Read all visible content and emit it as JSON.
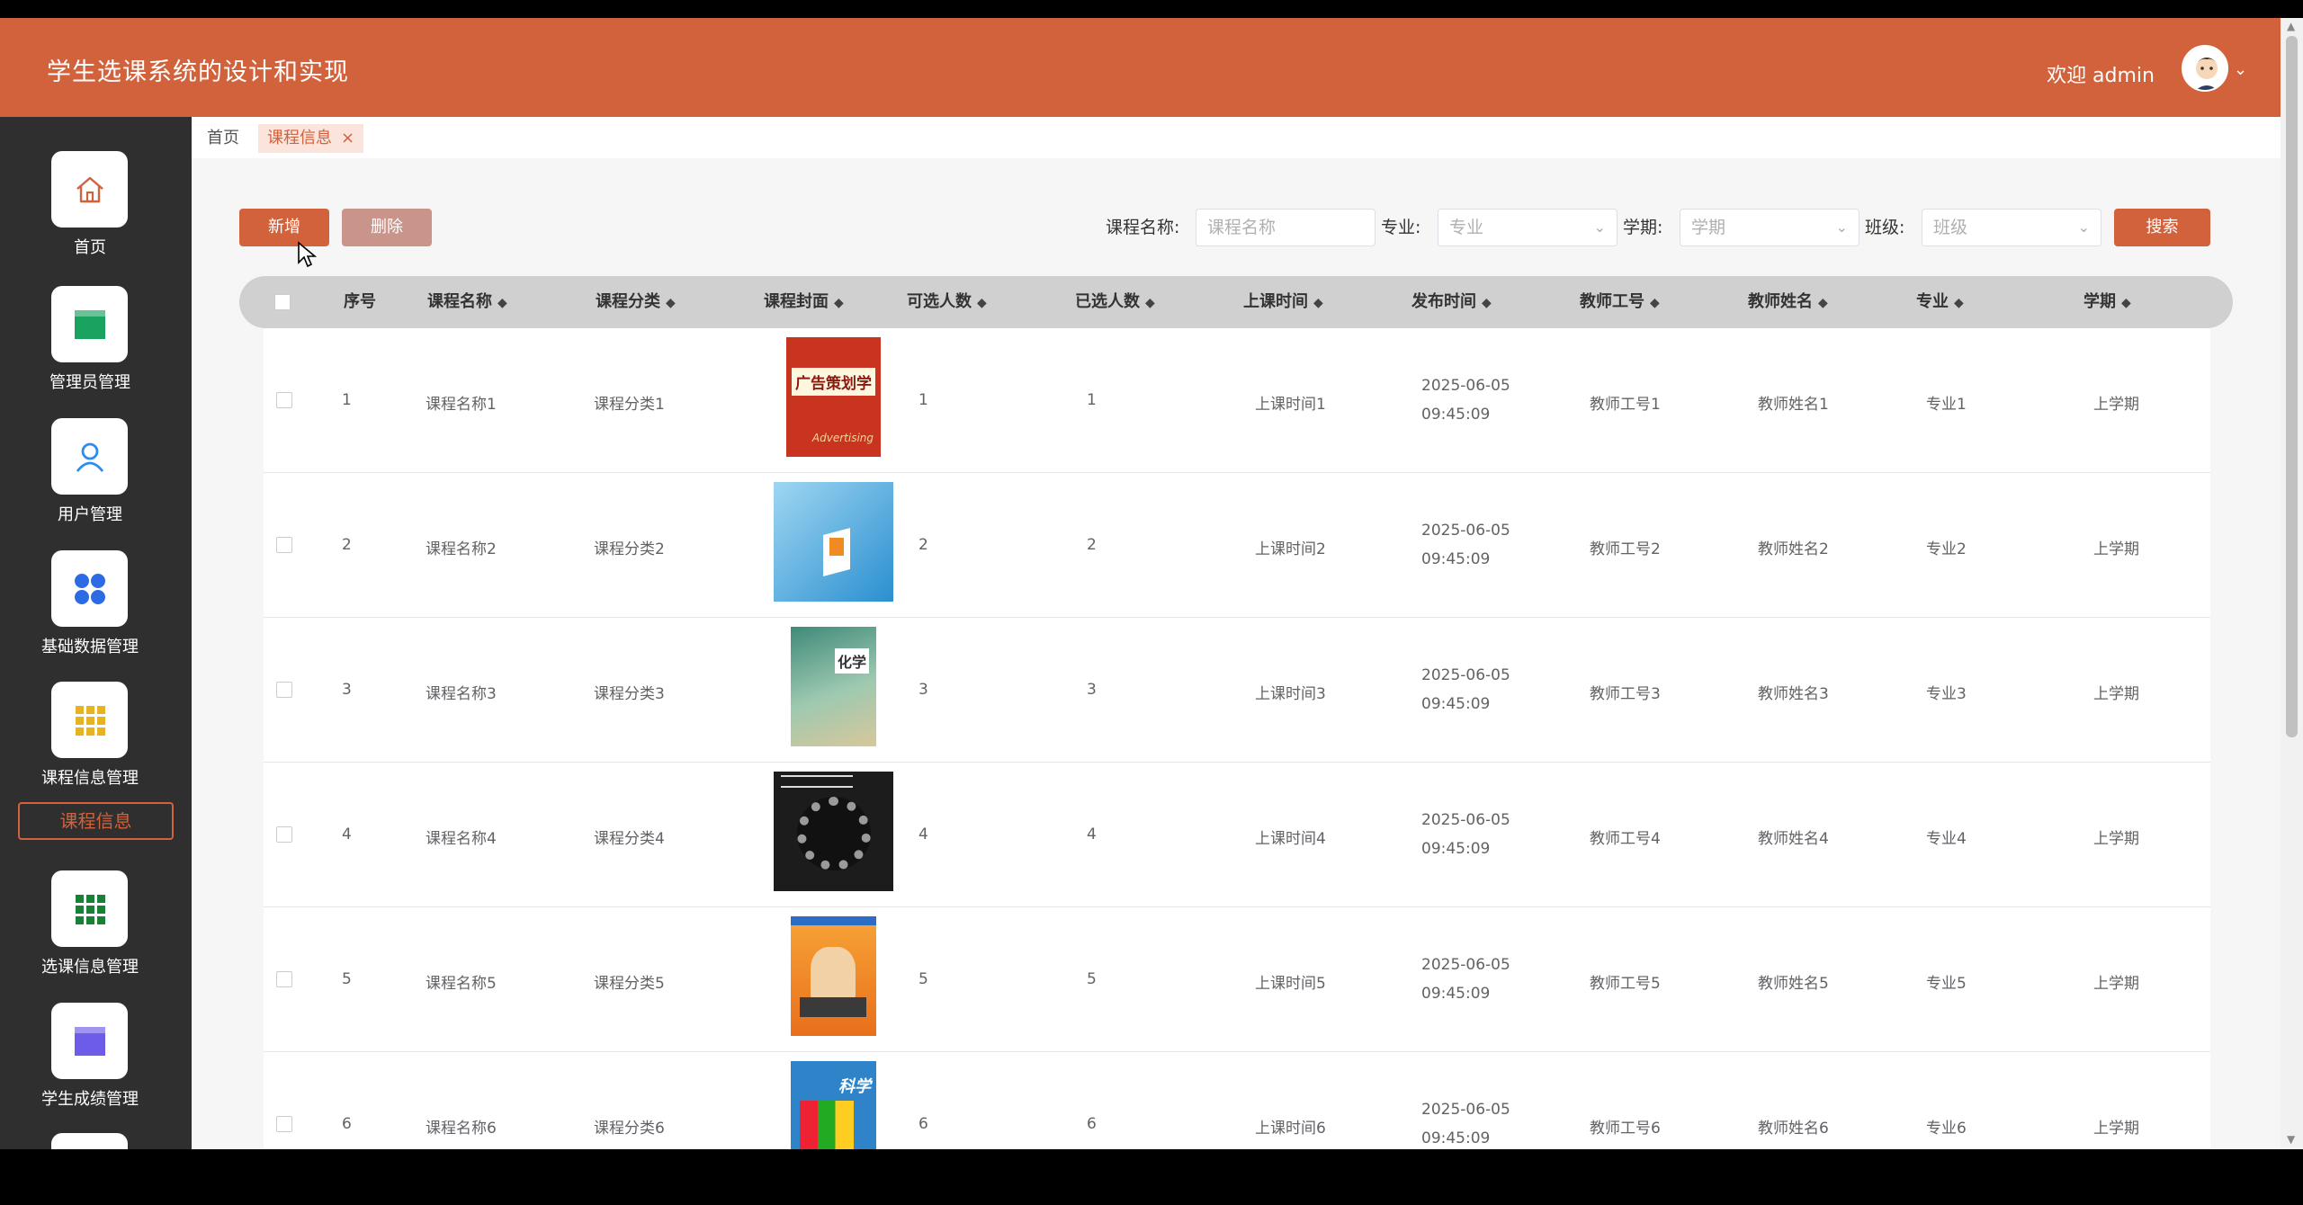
{
  "header": {
    "title": "学生选课系统的设计和实现",
    "welcome": "欢迎 admin"
  },
  "sidebar": {
    "items": [
      {
        "label": "首页",
        "icon": "home-icon",
        "color": "#d2623c"
      },
      {
        "label": "管理员管理",
        "icon": "card-icon",
        "color": "#1aa260"
      },
      {
        "label": "用户管理",
        "icon": "user-icon",
        "color": "#2d8cf0"
      },
      {
        "label": "基础数据管理",
        "icon": "dots-icon",
        "color": "#2d6be4"
      },
      {
        "label": "课程信息管理",
        "icon": "grid-icon",
        "color": "#e6b422"
      },
      {
        "label": "选课信息管理",
        "icon": "grid-icon",
        "color": "#1a7f37"
      },
      {
        "label": "学生成绩管理",
        "icon": "card-icon",
        "color": "#6c5ce7"
      }
    ],
    "sub_active": "课程信息"
  },
  "tabs": {
    "home": "首页",
    "current": "课程信息",
    "close": "×"
  },
  "toolbar": {
    "add": "新增",
    "delete": "删除",
    "search": "搜索"
  },
  "filters": {
    "course_name_label": "课程名称:",
    "course_name_placeholder": "课程名称",
    "major_label": "专业:",
    "major_placeholder": "专业",
    "term_label": "学期:",
    "term_placeholder": "学期",
    "class_label": "班级:",
    "class_placeholder": "班级"
  },
  "table": {
    "columns": [
      "序号",
      "课程名称",
      "课程分类",
      "课程封面",
      "可选人数",
      "已选人数",
      "上课时间",
      "发布时间",
      "教师工号",
      "教师姓名",
      "专业",
      "学期"
    ],
    "rows": [
      {
        "id": "1",
        "name": "课程名称1",
        "category": "课程分类1",
        "capacity": "1",
        "selected": "1",
        "time": "上课时间1",
        "published": "2025-06-05 09:45:09",
        "teacher_no": "教师工号1",
        "teacher": "教师姓名1",
        "major": "专业1",
        "term": "上学期",
        "cover_title": "广告策划学",
        "cover_sub": "Advertising"
      },
      {
        "id": "2",
        "name": "课程名称2",
        "category": "课程分类2",
        "capacity": "2",
        "selected": "2",
        "time": "上课时间2",
        "published": "2025-06-05 09:45:09",
        "teacher_no": "教师工号2",
        "teacher": "教师姓名2",
        "major": "专业2",
        "term": "上学期",
        "cover_title": "",
        "cover_sub": ""
      },
      {
        "id": "3",
        "name": "课程名称3",
        "category": "课程分类3",
        "capacity": "3",
        "selected": "3",
        "time": "上课时间3",
        "published": "2025-06-05 09:45:09",
        "teacher_no": "教师工号3",
        "teacher": "教师姓名3",
        "major": "专业3",
        "term": "上学期",
        "cover_title": "化学",
        "cover_sub": ""
      },
      {
        "id": "4",
        "name": "课程名称4",
        "category": "课程分类4",
        "capacity": "4",
        "selected": "4",
        "time": "上课时间4",
        "published": "2025-06-05 09:45:09",
        "teacher_no": "教师工号4",
        "teacher": "教师姓名4",
        "major": "专业4",
        "term": "上学期",
        "cover_title": "",
        "cover_sub": ""
      },
      {
        "id": "5",
        "name": "课程名称5",
        "category": "课程分类5",
        "capacity": "5",
        "selected": "5",
        "time": "上课时间5",
        "published": "2025-06-05 09:45:09",
        "teacher_no": "教师工号5",
        "teacher": "教师姓名5",
        "major": "专业5",
        "term": "上学期",
        "cover_title": "",
        "cover_sub": ""
      },
      {
        "id": "6",
        "name": "课程名称6",
        "category": "课程分类6",
        "capacity": "6",
        "selected": "6",
        "time": "上课时间6",
        "published": "2025-06-05 09:45:09",
        "teacher_no": "教师工号6",
        "teacher": "教师姓名6",
        "major": "专业6",
        "term": "上学期",
        "cover_title": "科学",
        "cover_sub": ""
      }
    ]
  }
}
